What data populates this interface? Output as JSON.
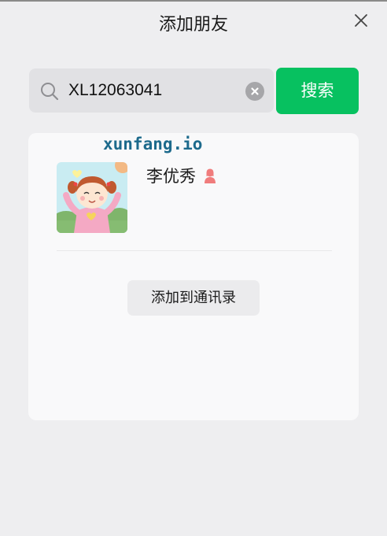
{
  "dialog": {
    "title": "添加朋友"
  },
  "search": {
    "query": "XL12063041",
    "button_label": "搜索"
  },
  "result": {
    "watermark": "xunfang.io",
    "name": "李优秀",
    "gender": "female",
    "add_button_label": "添加到通讯录"
  },
  "icons": {
    "close": "close-icon",
    "search": "search-icon",
    "clear": "clear-icon",
    "gender": "female-person-icon",
    "avatar": "cartoon-girl-avatar"
  },
  "colors": {
    "accent": "#07c160",
    "gender_icon": "#f07c7c"
  }
}
